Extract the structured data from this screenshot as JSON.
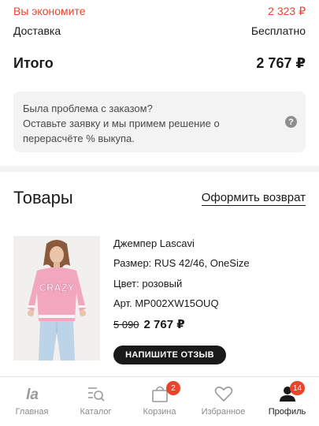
{
  "summary": {
    "savings_label": "Вы экономите",
    "savings_value": "2 323 ₽",
    "delivery_label": "Доставка",
    "delivery_value": "Бесплатно",
    "total_label": "Итого",
    "total_value": "2 767 ₽"
  },
  "problem": {
    "text_line1": "Была проблема с заказом?",
    "text_line2": "Оставьте заявку и мы примем решение о",
    "text_line3": "перерасчёте % выкупа.",
    "help_glyph": "?"
  },
  "goods": {
    "title": "Товары",
    "return_link": "Оформить возврат"
  },
  "product": {
    "name": "Джемпер Lascavi",
    "size": "Размер: RUS 42/46, OneSize",
    "color": "Цвет: розовый",
    "sku": "Арт. MP002XW15OUQ",
    "old_price": "5 090",
    "new_price": "2 767 ₽",
    "review_button": "НАПИШИТЕ ОТЗЫВ",
    "image_text": "CRAZY"
  },
  "tabbar": {
    "items": [
      {
        "label": "Главная",
        "icon": "la-logo-icon"
      },
      {
        "label": "Каталог",
        "icon": "catalog-search-icon"
      },
      {
        "label": "Корзина",
        "icon": "cart-bag-icon",
        "badge": "2"
      },
      {
        "label": "Избранное",
        "icon": "heart-icon"
      },
      {
        "label": "Профиль",
        "icon": "profile-icon",
        "badge": "14"
      }
    ]
  },
  "colors": {
    "accent": "#e8452c",
    "text": "#1a1a1a",
    "muted": "#8a8a8a",
    "panel": "#f3f3f3"
  }
}
